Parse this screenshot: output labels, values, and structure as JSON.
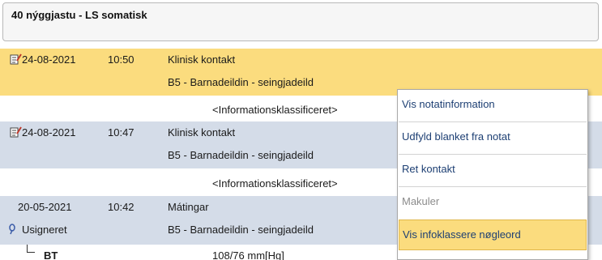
{
  "header": {
    "title": "40 nýggjastu - LS somatisk"
  },
  "entries": [
    {
      "date": "24-08-2021",
      "time": "10:50",
      "type": "Klinisk kontakt",
      "department": "B5 - Barnadeildin - seingjadeild",
      "classification": "<Informationsklassificeret>"
    },
    {
      "date": "24-08-2021",
      "time": "10:47",
      "type": "Klinisk kontakt",
      "department": "B5 - Barnadeildin - seingjadeild",
      "classification": "<Informationsklassificeret>"
    },
    {
      "date": "20-05-2021",
      "time": "10:42",
      "type": "Mátingar",
      "status": "Usigneret",
      "department": "B5 - Barnadeildin - seingjadeild",
      "sub_label": "BT",
      "sub_value": "108/76 mm[Hg]"
    }
  ],
  "context_menu": {
    "items": [
      {
        "label": "Vis notatinformation",
        "state": "normal"
      },
      {
        "label": "Udfyld blanket fra notat",
        "state": "normal"
      },
      {
        "label": "Ret kontakt",
        "state": "normal"
      },
      {
        "label": "Makuler",
        "state": "disabled"
      },
      {
        "label": "Vis infoklassere nøgleord",
        "state": "active"
      }
    ]
  },
  "colors": {
    "selected_row": "#fbdc7e",
    "shaded_row": "#d4dce8",
    "menu_text": "#1d3f73"
  }
}
